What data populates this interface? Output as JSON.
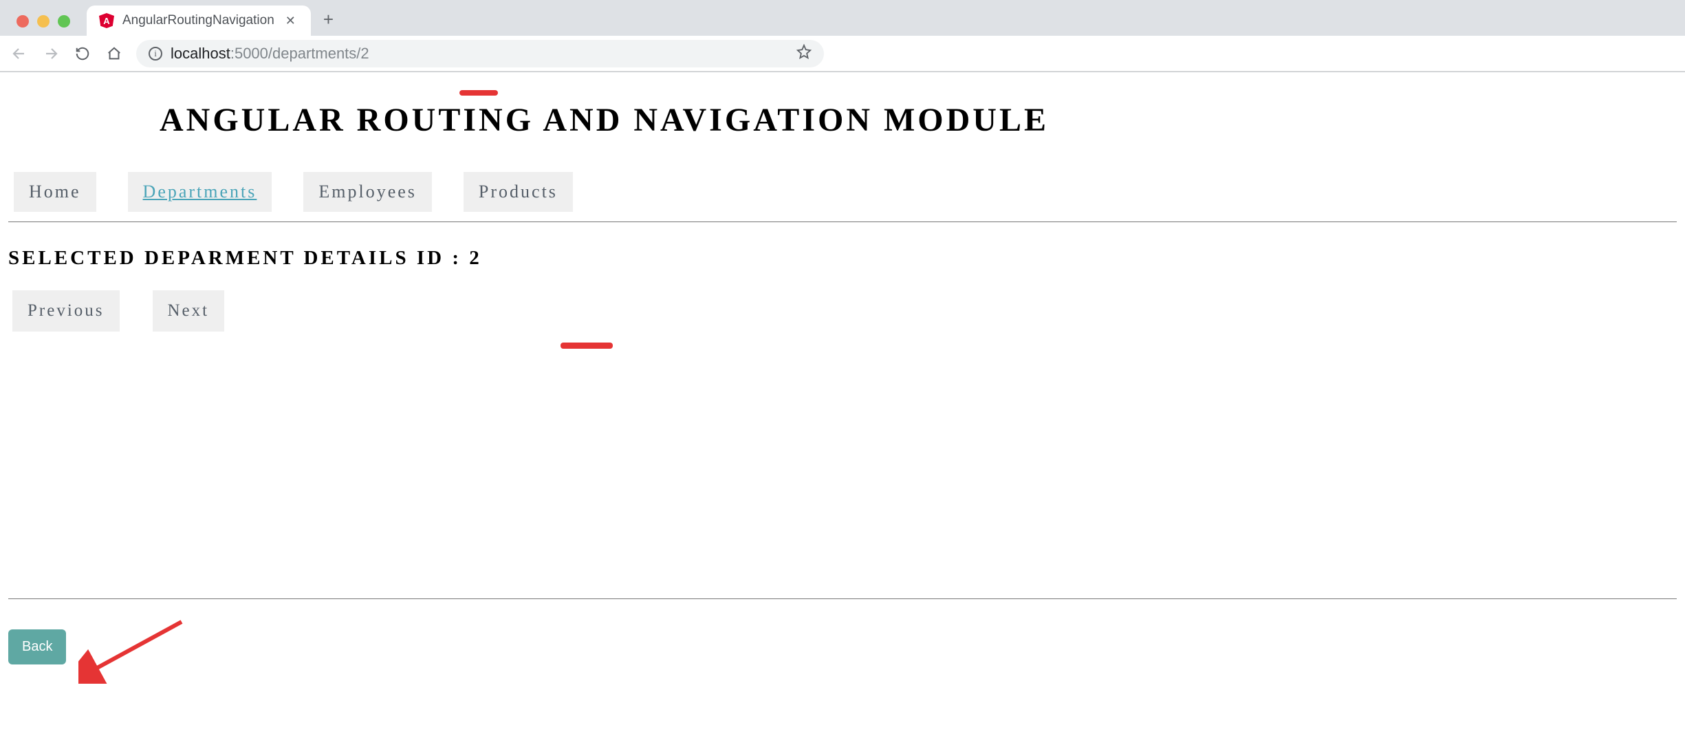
{
  "browser": {
    "tab_title": "AngularRoutingNavigation",
    "url_host": "localhost",
    "url_path": ":5000/departments/2"
  },
  "page": {
    "title": "ANGULAR ROUTING AND NAVIGATION MODULE"
  },
  "nav": {
    "items": [
      {
        "label": "Home"
      },
      {
        "label": "Departments"
      },
      {
        "label": "Employees"
      },
      {
        "label": "Products"
      }
    ]
  },
  "details": {
    "heading_prefix": "SELECTED DEPARMENT DETAILS ID : ",
    "id": "2"
  },
  "pager": {
    "prev_label": "Previous",
    "next_label": "Next"
  },
  "footer": {
    "back_label": "Back"
  }
}
